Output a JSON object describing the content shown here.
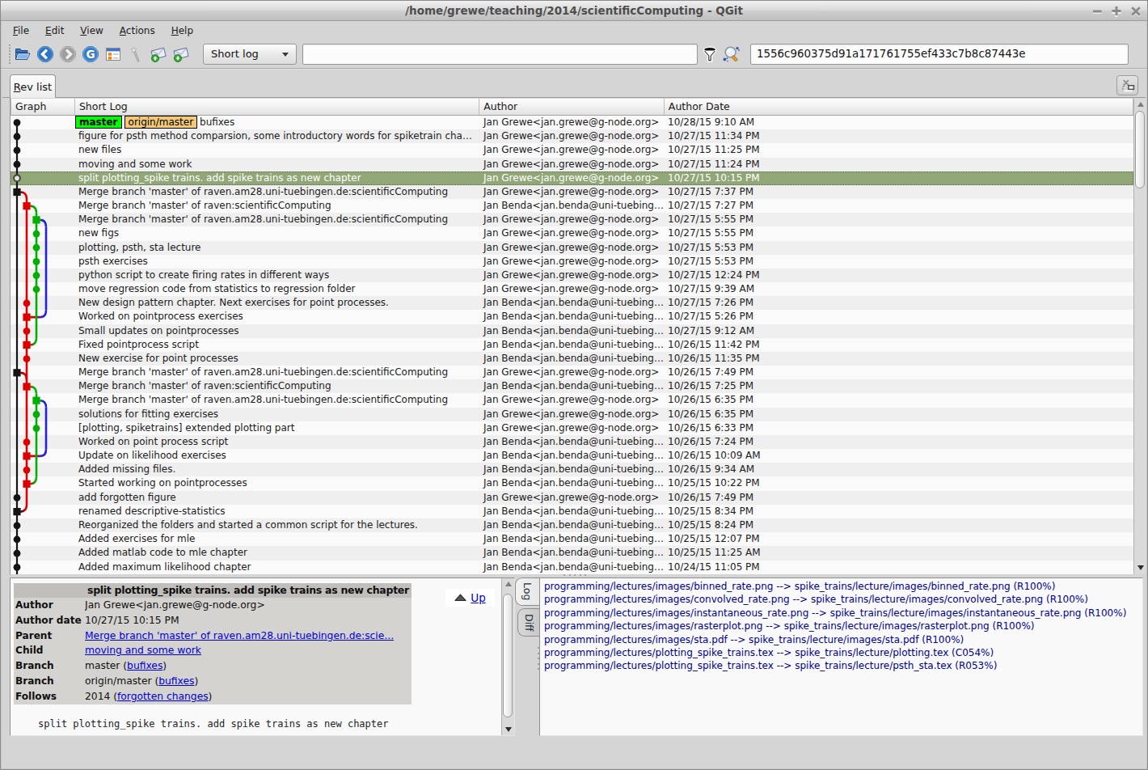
{
  "window": {
    "title": "/home/grewe/teaching/2014/scientificComputing - QGit",
    "controls": {
      "minimize": "–",
      "maximize": "+",
      "close": "✕"
    }
  },
  "menu": {
    "items": [
      {
        "label": "File",
        "mnemonic": "F"
      },
      {
        "label": "Edit",
        "mnemonic": "E"
      },
      {
        "label": "View",
        "mnemonic": "V"
      },
      {
        "label": "Actions",
        "mnemonic": "A"
      },
      {
        "label": "Help",
        "mnemonic": "H"
      }
    ]
  },
  "toolbar": {
    "icons": [
      {
        "name": "open-repository-icon",
        "enabled": true
      },
      {
        "name": "back-icon",
        "enabled": true
      },
      {
        "name": "forward-icon",
        "enabled": false
      },
      {
        "name": "home-icon",
        "enabled": true
      },
      {
        "name": "tree-view-icon",
        "enabled": true
      },
      {
        "name": "wand-icon",
        "enabled": false
      },
      {
        "name": "save-patch-icon",
        "enabled": true
      },
      {
        "name": "apply-patch-icon",
        "enabled": true
      }
    ],
    "view_combo_value": "Short log",
    "filter_value": "",
    "sha_value": "1556c960375d91a171761755ef433c7b8c87443e",
    "filter_icon": "funnel-icon",
    "find_icon": "search-highlight-icon"
  },
  "tabs": [
    {
      "label": "Rev list",
      "mnemonic": "R"
    }
  ],
  "rev_table": {
    "columns": [
      "Graph",
      "Short Log",
      "Author",
      "Author Date"
    ],
    "selected_row": 5,
    "rows": [
      {
        "log": "bufixes",
        "badges": [
          {
            "text": "master",
            "type": "branch"
          },
          {
            "text": "origin/master",
            "type": "remote"
          }
        ],
        "author": "Jan Grewe<jan.grewe@g-node.org>",
        "date": "10/28/15 9:10 AM",
        "node": {
          "lane": 0,
          "shape": "dot",
          "color": "black"
        }
      },
      {
        "log": "figure for psth method comparsion, some introductory words for spiketrain cha…",
        "author": "Jan Grewe<jan.grewe@g-node.org>",
        "date": "10/27/15 11:34 PM",
        "node": {
          "lane": 0,
          "shape": "dot",
          "color": "black"
        }
      },
      {
        "log": "new files",
        "author": "Jan Grewe<jan.grewe@g-node.org>",
        "date": "10/27/15 11:25 PM",
        "node": {
          "lane": 0,
          "shape": "dot",
          "color": "black"
        }
      },
      {
        "log": "moving and some work",
        "author": "Jan Grewe<jan.grewe@g-node.org>",
        "date": "10/27/15 11:24 PM",
        "node": {
          "lane": 0,
          "shape": "dot",
          "color": "black"
        }
      },
      {
        "log": "split plotting_spike trains. add spike trains as new chapter",
        "author": "Jan Grewe<jan.grewe@g-node.org>",
        "date": "10/27/15 10:15 PM",
        "node": {
          "lane": 0,
          "shape": "ring",
          "color": "black"
        }
      },
      {
        "log": "Merge branch 'master' of raven.am28.uni-tuebingen.de:scientificComputing",
        "author": "Jan Grewe<jan.grewe@g-node.org>",
        "date": "10/27/15 7:37 PM",
        "node": {
          "lane": 0,
          "shape": "square",
          "color": "black"
        }
      },
      {
        "log": "Merge branch 'master' of raven:scientificComputing",
        "author": "Jan Benda<jan.benda@uni-tuebing…",
        "date": "10/27/15 7:27 PM",
        "node": {
          "lane": 1,
          "shape": "square",
          "color": "red"
        }
      },
      {
        "log": "Merge branch 'master' of raven.am28.uni-tuebingen.de:scientificComputing",
        "author": "Jan Grewe<jan.grewe@g-node.org>",
        "date": "10/27/15 5:55 PM",
        "node": {
          "lane": 2,
          "shape": "square",
          "color": "green"
        }
      },
      {
        "log": "new figs",
        "author": "Jan Grewe<jan.grewe@g-node.org>",
        "date": "10/27/15 5:55 PM",
        "node": {
          "lane": 2,
          "shape": "dot",
          "color": "green"
        }
      },
      {
        "log": "plotting, psth, sta lecture",
        "author": "Jan Grewe<jan.grewe@g-node.org>",
        "date": "10/27/15 5:53 PM",
        "node": {
          "lane": 2,
          "shape": "dot",
          "color": "green"
        }
      },
      {
        "log": "psth exercises",
        "author": "Jan Grewe<jan.grewe@g-node.org>",
        "date": "10/27/15 5:53 PM",
        "node": {
          "lane": 2,
          "shape": "dot",
          "color": "green"
        }
      },
      {
        "log": "python script to create firing rates in different ways",
        "author": "Jan Grewe<jan.grewe@g-node.org>",
        "date": "10/27/15 12:24 PM",
        "node": {
          "lane": 2,
          "shape": "dot",
          "color": "green"
        }
      },
      {
        "log": "move regression code from statistics to regression folder",
        "author": "Jan Grewe<jan.grewe@g-node.org>",
        "date": "10/27/15 9:39 AM",
        "node": {
          "lane": 2,
          "shape": "dot",
          "color": "green"
        }
      },
      {
        "log": "New design pattern chapter. Next exercises for point processes.",
        "author": "Jan Benda<jan.benda@uni-tuebing…",
        "date": "10/27/15 7:26 PM",
        "node": {
          "lane": 1,
          "shape": "dot",
          "color": "red"
        }
      },
      {
        "log": "Worked on pointprocess exercises",
        "author": "Jan Benda<jan.benda@uni-tuebing…",
        "date": "10/27/15 5:26 PM",
        "node": {
          "lane": 1,
          "shape": "square",
          "color": "red"
        }
      },
      {
        "log": "Small updates on pointprocesses",
        "author": "Jan Benda<jan.benda@uni-tuebing…",
        "date": "10/27/15 9:12 AM",
        "node": {
          "lane": 1,
          "shape": "dot",
          "color": "red"
        }
      },
      {
        "log": "Fixed pointprocess script",
        "author": "Jan Benda<jan.benda@uni-tuebing…",
        "date": "10/26/15 11:42 PM",
        "node": {
          "lane": 1,
          "shape": "square",
          "color": "red"
        }
      },
      {
        "log": "New exercise for point processes",
        "author": "Jan Benda<jan.benda@uni-tuebing…",
        "date": "10/26/15 11:35 PM",
        "node": {
          "lane": 1,
          "shape": "dot",
          "color": "red"
        }
      },
      {
        "log": "Merge branch 'master' of raven.am28.uni-tuebingen.de:scientificComputing",
        "author": "Jan Grewe<jan.grewe@g-node.org>",
        "date": "10/26/15 7:49 PM",
        "node": {
          "lane": 0,
          "shape": "square",
          "color": "black"
        }
      },
      {
        "log": "Merge branch 'master' of raven:scientificComputing",
        "author": "Jan Benda<jan.benda@uni-tuebing…",
        "date": "10/26/15 7:25 PM",
        "node": {
          "lane": 1,
          "shape": "square",
          "color": "red"
        }
      },
      {
        "log": "Merge branch 'master' of raven.am28.uni-tuebingen.de:scientificComputing",
        "author": "Jan Grewe<jan.grewe@g-node.org>",
        "date": "10/26/15 6:35 PM",
        "node": {
          "lane": 2,
          "shape": "square",
          "color": "green"
        }
      },
      {
        "log": "solutions for fitting exercises",
        "author": "Jan Grewe<jan.grewe@g-node.org>",
        "date": "10/26/15 6:35 PM",
        "node": {
          "lane": 2,
          "shape": "dot",
          "color": "green"
        }
      },
      {
        "log": "[plotting, spiketrains] extended plotting part",
        "author": "Jan Grewe<jan.grewe@g-node.org>",
        "date": "10/26/15 6:33 PM",
        "node": {
          "lane": 2,
          "shape": "dot",
          "color": "green"
        }
      },
      {
        "log": "Worked on point process script",
        "author": "Jan Benda<jan.benda@uni-tuebing…",
        "date": "10/26/15 7:24 PM",
        "node": {
          "lane": 1,
          "shape": "dot",
          "color": "red"
        }
      },
      {
        "log": "Update on likelihood exercises",
        "author": "Jan Benda<jan.benda@uni-tuebing…",
        "date": "10/26/15 10:09 AM",
        "node": {
          "lane": 1,
          "shape": "square",
          "color": "red"
        }
      },
      {
        "log": "Added missing files.",
        "author": "Jan Benda<jan.benda@uni-tuebing…",
        "date": "10/26/15 9:34 AM",
        "node": {
          "lane": 1,
          "shape": "dot",
          "color": "red"
        }
      },
      {
        "log": "Started working on pointprocesses",
        "author": "Jan Benda<jan.benda@uni-tuebing…",
        "date": "10/25/15 10:22 PM",
        "node": {
          "lane": 1,
          "shape": "square",
          "color": "red"
        }
      },
      {
        "log": "add forgotten figure",
        "author": "Jan Grewe<jan.grewe@g-node.org>",
        "date": "10/26/15 7:49 PM",
        "node": {
          "lane": 0,
          "shape": "dot",
          "color": "black"
        }
      },
      {
        "log": "renamed descriptive-statistics",
        "author": "Jan Benda<jan.benda@uni-tuebing…",
        "date": "10/25/15 8:34 PM",
        "node": {
          "lane": 0,
          "shape": "square",
          "color": "black"
        }
      },
      {
        "log": "Reorganized the folders and started a common script for the lectures.",
        "author": "Jan Benda<jan.benda@uni-tuebing…",
        "date": "10/25/15 8:24 PM",
        "node": {
          "lane": 0,
          "shape": "dot",
          "color": "black"
        }
      },
      {
        "log": "Added exercises for mle",
        "author": "Jan Benda<jan.benda@uni-tuebing…",
        "date": "10/25/15 12:07 PM",
        "node": {
          "lane": 0,
          "shape": "dot",
          "color": "black"
        }
      },
      {
        "log": "Added matlab code to mle chapter",
        "author": "Jan Benda<jan.benda@uni-tuebing…",
        "date": "10/25/15 11:25 AM",
        "node": {
          "lane": 0,
          "shape": "dot",
          "color": "black"
        }
      },
      {
        "log": "Added maximum likelihood chapter",
        "author": "Jan Benda<jan.benda@uni-tuebing…",
        "date": "10/24/15 11:05 PM",
        "node": {
          "lane": 0,
          "shape": "dot",
          "color": "black"
        }
      }
    ]
  },
  "graph": {
    "lane_x": [
      21,
      33,
      45,
      57
    ],
    "colors": {
      "black": "#141414",
      "red": "#dd0000",
      "green": "#00b000",
      "blue": "#2222dd"
    },
    "verticals": [
      {
        "lane": 0,
        "top_row": 1,
        "bottom_row": -1,
        "color": "black"
      },
      {
        "lane": 1,
        "top_row": 6,
        "bottom_row": 29,
        "color": "red"
      },
      {
        "lane": 2,
        "top_row": 7,
        "bottom_row": 17,
        "color": "green"
      },
      {
        "lane": 3,
        "top_row": 8,
        "bottom_row": 15,
        "color": "blue"
      },
      {
        "lane": 2,
        "top_row": 20,
        "bottom_row": 27,
        "color": "green"
      },
      {
        "lane": 3,
        "top_row": 21,
        "bottom_row": 25,
        "color": "blue"
      }
    ],
    "arcs": [
      {
        "row": 6,
        "from_lane": 0,
        "to_lane": 1,
        "dir": "open",
        "c1": "black",
        "c2": "red"
      },
      {
        "row": 7,
        "from_lane": 1,
        "to_lane": 2,
        "dir": "open",
        "c1": "red",
        "c2": "green"
      },
      {
        "row": 8,
        "from_lane": 2,
        "to_lane": 3,
        "dir": "open",
        "c1": "green",
        "c2": "blue"
      },
      {
        "row": 15,
        "from_lane": 1,
        "to_lane": 3,
        "dir": "close",
        "c1": "red",
        "c2": "blue"
      },
      {
        "row": 17,
        "from_lane": 1,
        "to_lane": 2,
        "dir": "close",
        "c1": "red",
        "c2": "green"
      },
      {
        "row": 19,
        "from_lane": 0,
        "to_lane": 1,
        "dir": "open",
        "c1": "black",
        "c2": "red"
      },
      {
        "row": 20,
        "from_lane": 1,
        "to_lane": 2,
        "dir": "open",
        "c1": "red",
        "c2": "green"
      },
      {
        "row": 21,
        "from_lane": 2,
        "to_lane": 3,
        "dir": "open",
        "c1": "green",
        "c2": "blue"
      },
      {
        "row": 25,
        "from_lane": 1,
        "to_lane": 3,
        "dir": "close",
        "c1": "red",
        "c2": "blue"
      },
      {
        "row": 27,
        "from_lane": 1,
        "to_lane": 2,
        "dir": "close",
        "c1": "red",
        "c2": "green"
      },
      {
        "row": 29,
        "from_lane": 0,
        "to_lane": 1,
        "dir": "close",
        "c1": "black",
        "c2": "red"
      }
    ]
  },
  "details": {
    "title": "split plotting_spike trains. add spike trains as new chapter",
    "fields": [
      {
        "label": "Author",
        "parts": [
          {
            "text": "Jan Grewe<jan.grewe@g-node.org>"
          }
        ]
      },
      {
        "label": "Author date",
        "parts": [
          {
            "text": "10/27/15 10:15 PM"
          }
        ]
      },
      {
        "label": "Parent",
        "parts": [
          {
            "link": "Merge branch 'master' of raven.am28.uni-tuebingen.de:scie..."
          }
        ]
      },
      {
        "label": "Child",
        "parts": [
          {
            "link": "moving and some work"
          }
        ]
      },
      {
        "label": "Branch",
        "parts": [
          {
            "text": "master ("
          },
          {
            "link": "bufixes"
          },
          {
            "text": ")"
          }
        ]
      },
      {
        "label": "Branch",
        "parts": [
          {
            "text": "origin/master ("
          },
          {
            "link": "bufixes"
          },
          {
            "text": ")"
          }
        ]
      },
      {
        "label": "Follows",
        "parts": [
          {
            "text": "2014 ("
          },
          {
            "link": "forgotten changes"
          },
          {
            "text": ")"
          }
        ]
      }
    ],
    "up_label": "Up",
    "message": "split plotting_spike trains. add spike trains as new chapter"
  },
  "side_tabs": [
    {
      "label": "Log",
      "selected": true
    },
    {
      "label": "Diff",
      "selected": false
    }
  ],
  "file_list": [
    "programming/lectures/images/binned_rate.png --> spike_trains/lecture/images/binned_rate.png (R100%)",
    "programming/lectures/images/convolved_rate.png --> spike_trains/lecture/images/convolved_rate.png (R100%)",
    "programming/lectures/images/instantaneous_rate.png --> spike_trains/lecture/images/instantaneous_rate.png (R100%)",
    "programming/lectures/images/rasterplot.png --> spike_trains/lecture/images/rasterplot.png (R100%)",
    "programming/lectures/images/sta.pdf --> spike_trains/lecture/images/sta.pdf (R100%)",
    "programming/lectures/plotting_spike_trains.tex --> spike_trains/lecture/plotting.tex (C054%)",
    "programming/lectures/plotting_spike_trains.tex --> spike_trains/lecture/psth_sta.tex (R053%)"
  ]
}
